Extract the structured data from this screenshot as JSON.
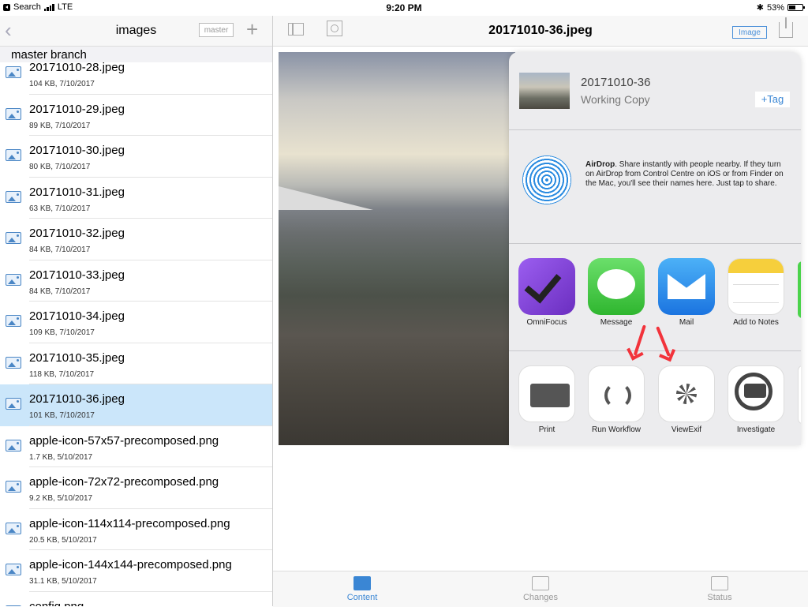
{
  "status_bar": {
    "back_app": "Search",
    "carrier": "LTE",
    "time": "9:20 PM",
    "bluetooth": "✱",
    "battery_percent": "53%",
    "battery_level": 0.53
  },
  "left_panel": {
    "back_glyph": "‹",
    "title": "images",
    "branch_button": "master",
    "add_glyph": "+",
    "branch_header": "master branch",
    "files": [
      {
        "name": "20171010-28.jpeg",
        "meta": "104 KB, 7/10/2017",
        "selected": false
      },
      {
        "name": "20171010-29.jpeg",
        "meta": "89 KB, 7/10/2017",
        "selected": false
      },
      {
        "name": "20171010-30.jpeg",
        "meta": "80 KB, 7/10/2017",
        "selected": false
      },
      {
        "name": "20171010-31.jpeg",
        "meta": "63 KB, 7/10/2017",
        "selected": false
      },
      {
        "name": "20171010-32.jpeg",
        "meta": "84 KB, 7/10/2017",
        "selected": false
      },
      {
        "name": "20171010-33.jpeg",
        "meta": "84 KB, 7/10/2017",
        "selected": false
      },
      {
        "name": "20171010-34.jpeg",
        "meta": "109 KB, 7/10/2017",
        "selected": false
      },
      {
        "name": "20171010-35.jpeg",
        "meta": "118 KB, 7/10/2017",
        "selected": false
      },
      {
        "name": "20171010-36.jpeg",
        "meta": "101 KB, 7/10/2017",
        "selected": true
      },
      {
        "name": "apple-icon-57x57-precomposed.png",
        "meta": "1.7 KB, 5/10/2017",
        "selected": false
      },
      {
        "name": "apple-icon-72x72-precomposed.png",
        "meta": "9.2 KB, 5/10/2017",
        "selected": false
      },
      {
        "name": "apple-icon-114x114-precomposed.png",
        "meta": "20.5 KB, 5/10/2017",
        "selected": false
      },
      {
        "name": "apple-icon-144x144-precomposed.png",
        "meta": "31.1 KB, 5/10/2017",
        "selected": false
      },
      {
        "name": "config.png",
        "meta": "",
        "selected": false
      }
    ]
  },
  "right_panel": {
    "title": "20171010-36.jpeg",
    "image_button": "Image",
    "tabs": [
      {
        "label": "Content",
        "icon": "photo-icon",
        "active": true
      },
      {
        "label": "Changes",
        "icon": "changes-icon",
        "active": false
      },
      {
        "label": "Status",
        "icon": "clipboard-icon",
        "active": false
      }
    ]
  },
  "share_sheet": {
    "doc_name": "20171010-36",
    "doc_sub": "Working Copy",
    "tag_button": "+Tag",
    "airdrop_title": "AirDrop",
    "airdrop_text": ". Share instantly with people nearby. If they turn on AirDrop from Control Centre on iOS or from Finder on the Mac, you'll see their names here. Just tap to share.",
    "apps": [
      {
        "label": "OmniFocus",
        "icon": "omnifocus-icon"
      },
      {
        "label": "Message",
        "icon": "messages-icon"
      },
      {
        "label": "Mail",
        "icon": "mail-icon"
      },
      {
        "label": "Add to Notes",
        "icon": "notes-icon"
      }
    ],
    "actions": [
      {
        "label": "Print",
        "icon": "printer-icon"
      },
      {
        "label": "Run Workflow",
        "icon": "workflow-icon"
      },
      {
        "label": "ViewExif",
        "icon": "snowflake-icon"
      },
      {
        "label": "Investigate",
        "icon": "camera-magnifier-icon"
      }
    ]
  },
  "colors": {
    "accent": "#3a86d4",
    "selection": "#cbe6fa",
    "annotation_arrow": "#f2333b"
  }
}
